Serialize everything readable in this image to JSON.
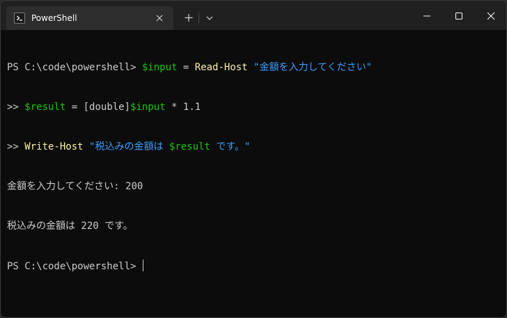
{
  "window": {
    "tab_title": "PowerShell",
    "tab_icon": "powershell-prompt-icon",
    "controls": [
      "new-tab-plus-icon",
      "dropdown-chevron-icon",
      "minimize-icon",
      "maximize-icon",
      "close-icon"
    ]
  },
  "colors": {
    "terminal_bg": "#0c0c0c",
    "titlebar_bg": "#202020",
    "tab_bg": "#2d2d2d",
    "default_text": "#cccccc",
    "variable": "#16c60c",
    "command": "#f9f1a5",
    "string": "#3b9eff"
  },
  "terminal": {
    "line1": {
      "prompt": "PS C:\\code\\powershell> ",
      "var": "$input",
      "op": " = ",
      "cmd": "Read-Host",
      "space": " ",
      "str": "\"金額を入力してください\""
    },
    "line2": {
      "cont": ">> ",
      "var": "$result",
      "op": " = ",
      "type": "[double]",
      "var2": "$input",
      "op2": " * ",
      "num": "1.1"
    },
    "line3": {
      "cont": ">> ",
      "cmd": "Write-Host",
      "space": " ",
      "str_a": "\"税込みの金額は ",
      "var": "$result",
      "str_b": " です。\""
    },
    "line4": "金額を入力してください: 200",
    "line5": "税込みの金額は 220 です。",
    "line6": {
      "prompt": "PS C:\\code\\powershell> "
    }
  }
}
